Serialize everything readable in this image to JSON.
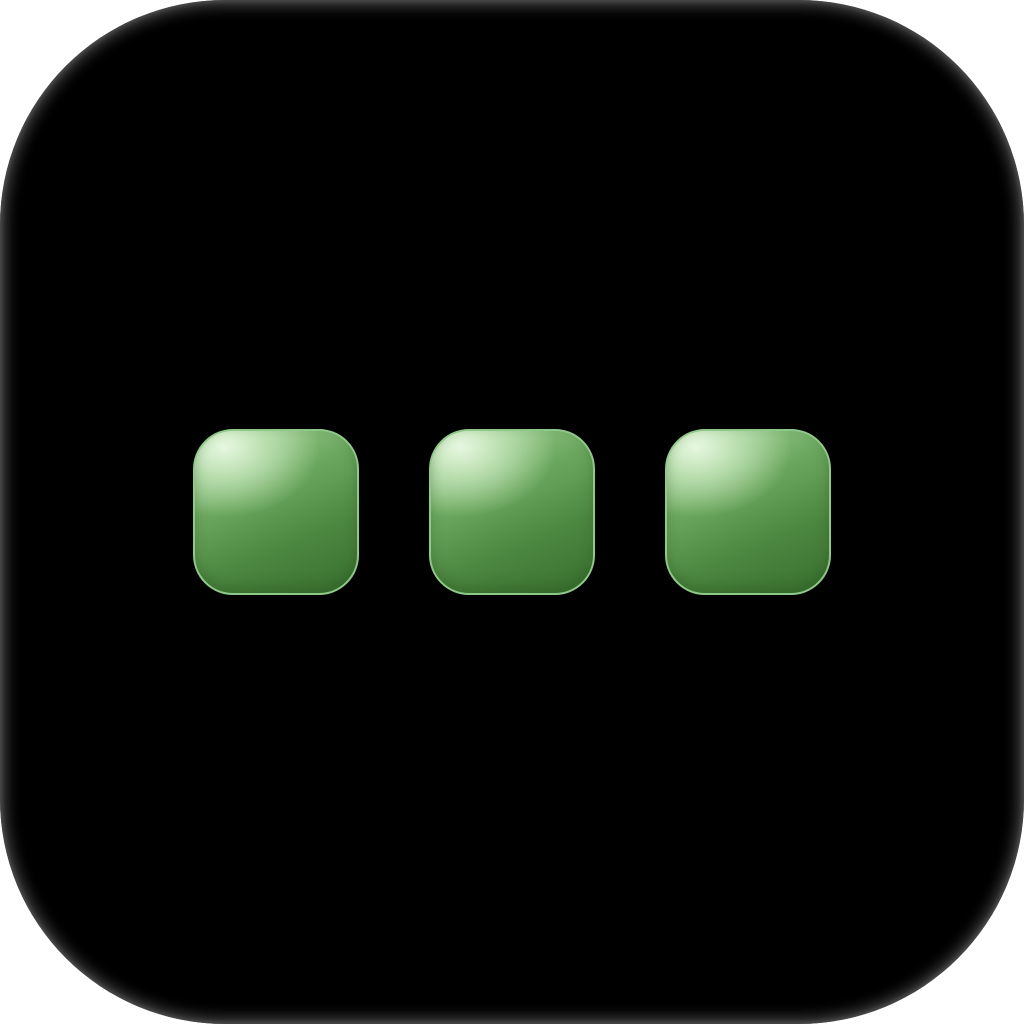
{
  "app_icon": {
    "name": "more-options-icon",
    "background_color": "#000000",
    "dots": [
      {
        "name": "dot-1",
        "color": "#5f9a52"
      },
      {
        "name": "dot-2",
        "color": "#5f9a52"
      },
      {
        "name": "dot-3",
        "color": "#5f9a52"
      }
    ]
  }
}
